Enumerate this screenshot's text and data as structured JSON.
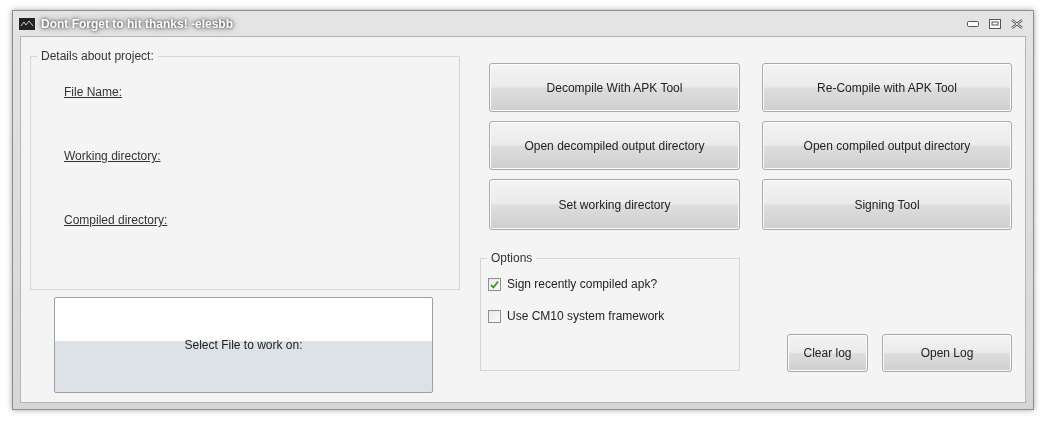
{
  "window": {
    "title": "Dont Forget to hit thanks! -elesbb"
  },
  "details": {
    "legend": "Details about project:",
    "fields": [
      "File Name:",
      "Working directory:",
      "Compiled directory:"
    ]
  },
  "select_file_button": "Select File to work on:",
  "buttons": [
    "Decompile With APK Tool",
    "Re-Compile with APK Tool",
    "Open decompiled output directory",
    "Open compiled output directory",
    "Set working directory",
    "Signing Tool"
  ],
  "options": {
    "legend": "Options",
    "checkboxes": [
      {
        "label": "Sign recently compiled apk?",
        "checked": true
      },
      {
        "label": "Use CM10 system framework",
        "checked": false
      }
    ]
  },
  "log_buttons": [
    "Clear log",
    "Open Log"
  ]
}
